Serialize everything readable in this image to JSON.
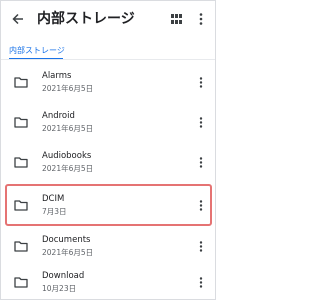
{
  "appbar": {
    "title": "内部ストレージ",
    "back_icon": "arrow-back-icon",
    "view_icon": "grid-view-icon",
    "menu_icon": "more-vert-icon"
  },
  "breadcrumb": {
    "label": "内部ストレージ",
    "color": "#1a73e8"
  },
  "items": [
    {
      "name": "Alarms",
      "date": "2021年6月5日"
    },
    {
      "name": "Android",
      "date": "2021年6月5日"
    },
    {
      "name": "Audiobooks",
      "date": "2021年6月5日"
    },
    {
      "name": "DCIM",
      "date": "7月3日"
    },
    {
      "name": "Documents",
      "date": "2021年6月5日"
    },
    {
      "name": "Download",
      "date": "10月23日"
    }
  ],
  "highlight_color": "#e57373"
}
